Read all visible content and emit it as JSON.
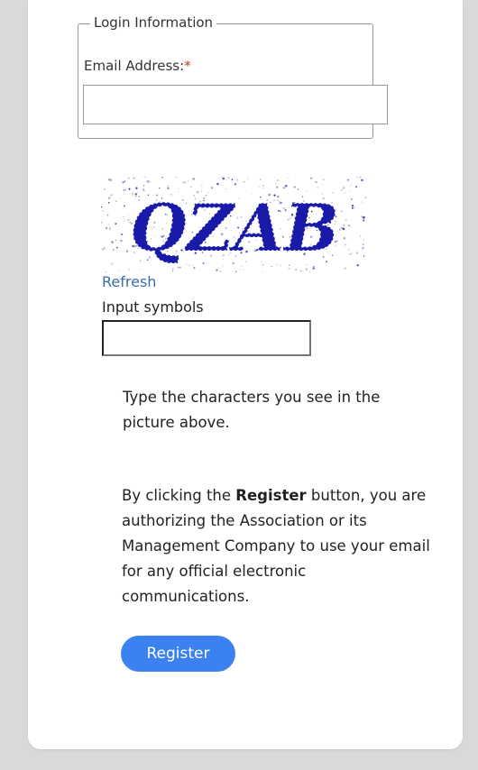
{
  "login_info": {
    "legend": "Login Information",
    "email_label": "Email Address:",
    "required_marker": "*",
    "email_value": ""
  },
  "captcha": {
    "text": "QZAB",
    "refresh_label": "Refresh",
    "input_label": "Input symbols",
    "input_value": ""
  },
  "hint": "Type the characters you see in the picture above.",
  "consent": {
    "prefix": "By clicking the ",
    "button_ref": "Register",
    "suffix": " button, you are authorizing the Association or its Management Company to use your email for any official electronic communications."
  },
  "register_button": "Register",
  "colors": {
    "accent": "#3b82f0",
    "link": "#3a6ea5",
    "required": "#c0392b",
    "captcha_ink": "#1a1aa8"
  }
}
